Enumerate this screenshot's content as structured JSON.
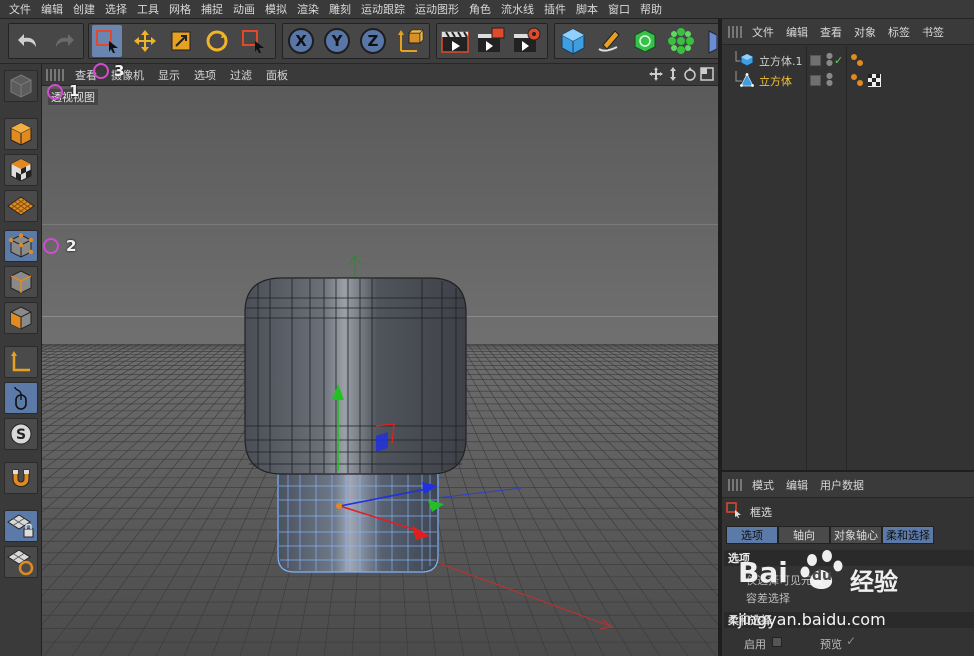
{
  "menu": [
    "文件",
    "编辑",
    "创建",
    "选择",
    "工具",
    "网格",
    "捕捉",
    "动画",
    "模拟",
    "渲染",
    "雕刻",
    "运动跟踪",
    "运动图形",
    "角色",
    "流水线",
    "插件",
    "脚本",
    "窗口",
    "帮助"
  ],
  "toolbar": {
    "axes": [
      "X",
      "Y",
      "Z"
    ],
    "icons": [
      "undo-icon",
      "redo-icon",
      "box-select-icon",
      "move-icon",
      "scale-icon",
      "rotate-icon",
      "last-tool-icon",
      "coordinate-system-icon",
      "render-view-icon",
      "render-picture-viewer-icon",
      "render-settings-icon",
      "cube-primitive-icon",
      "pen-icon",
      "subdivision-icon",
      "cloner-icon",
      "deformer-icon"
    ]
  },
  "viewport": {
    "menu": [
      "查看",
      "摄像机",
      "显示",
      "选项",
      "过滤",
      "面板"
    ],
    "camera_label": "透视视图",
    "markers": [
      "1",
      "2",
      "3"
    ]
  },
  "object_manager": {
    "menu": [
      "文件",
      "编辑",
      "查看",
      "对象",
      "标签",
      "书签"
    ],
    "objects": [
      {
        "name": "立方体.1",
        "color": "#d8d8d8",
        "check": "✓"
      },
      {
        "name": "立方体",
        "color": "#f2c230",
        "check": ""
      }
    ]
  },
  "attributes": {
    "menu": [
      "模式",
      "编辑",
      "用户数据"
    ],
    "tool_name": "框选",
    "tabs": [
      "选项",
      "轴向",
      "对象轴心",
      "柔和选择"
    ],
    "section_options": "选项",
    "row1": "仅选择可见元素",
    "row2": "容差选择",
    "section_soft": "柔和选择",
    "enable_label": "启用",
    "preview_label": "预览",
    "preview_check": "✓"
  },
  "watermark": {
    "brand": "Bai",
    "brand2": "du",
    "suffix": "经验",
    "url": "jingyan.baidu.com"
  },
  "colors": {
    "accent": "#5b7aa8",
    "marker": "#d14cd1",
    "selected_object": "#f2c230"
  }
}
